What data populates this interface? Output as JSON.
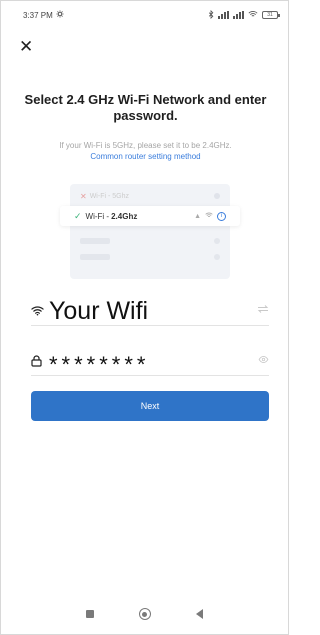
{
  "status_bar": {
    "time": "3:37 PM",
    "time_icon": "settings-gear-icon",
    "battery": "31"
  },
  "header": {
    "close_icon": "close-icon"
  },
  "title": "Select 2.4 GHz Wi-Fi Network and enter password.",
  "hint": "If your Wi-Fi is 5GHz, please set it to be 2.4GHz.",
  "help_link": "Common router setting method",
  "illustration": {
    "rejected_label": "Wi-Fi - 5Ghz",
    "accepted_prefix": "Wi-Fi -",
    "accepted_band": "2.4Ghz"
  },
  "wifi_field": {
    "value": "Your Wifi",
    "icon": "wifi-icon",
    "action_icon": "switch-network-icon"
  },
  "password_field": {
    "value": "********",
    "icon": "lock-icon",
    "action_icon": "eye-icon"
  },
  "next_button": "Next",
  "colors": {
    "accent": "#2f74c8",
    "link": "#3a7ddc",
    "check": "#3bb37a"
  }
}
